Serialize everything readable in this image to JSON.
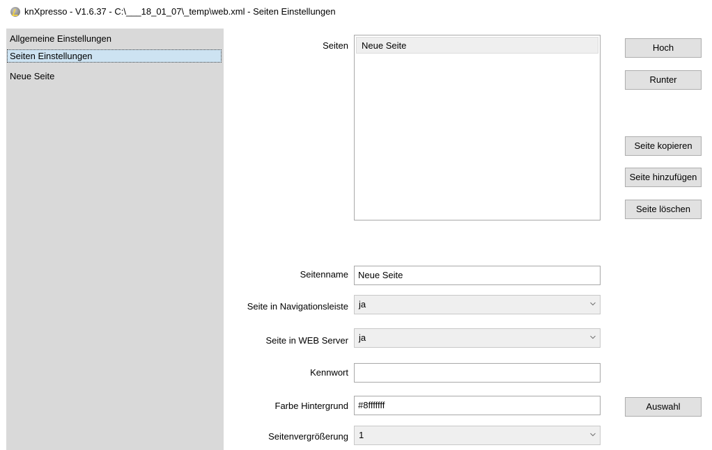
{
  "window": {
    "title": "knXpresso - V1.6.37 - C:\\___18_01_07\\_temp\\web.xml - Seiten Einstellungen",
    "icon": "knxpresso-app-icon"
  },
  "sidebar": {
    "items": [
      {
        "label": "Allgemeine Einstellungen",
        "selected": false
      },
      {
        "label": "Seiten Einstellungen",
        "selected": true
      },
      {
        "label": "Neue Seite",
        "selected": false
      }
    ]
  },
  "pages": {
    "label": "Seiten",
    "items": [
      "Neue Seite"
    ]
  },
  "buttons": {
    "up": "Hoch",
    "down": "Runter",
    "copy": "Seite kopieren",
    "add": "Seite hinzufügen",
    "delete": "Seite löschen",
    "choose": "Auswahl"
  },
  "form": {
    "page_name_label": "Seitenname",
    "page_name_value": "Neue Seite",
    "nav_label": "Seite in Navigationsleiste",
    "nav_value": "ja",
    "webserver_label": "Seite in WEB Server",
    "webserver_value": "ja",
    "password_label": "Kennwort",
    "password_value": "",
    "bg_color_label": "Farbe Hintergrund",
    "bg_color_value": "#8fffffff",
    "zoom_label": "Seitenvergrößerung",
    "zoom_value": "1"
  },
  "colors": {
    "sidebar_bg": "#d9d9d9",
    "selection": "#cde3f2",
    "button_bg": "#e1e1e1"
  }
}
